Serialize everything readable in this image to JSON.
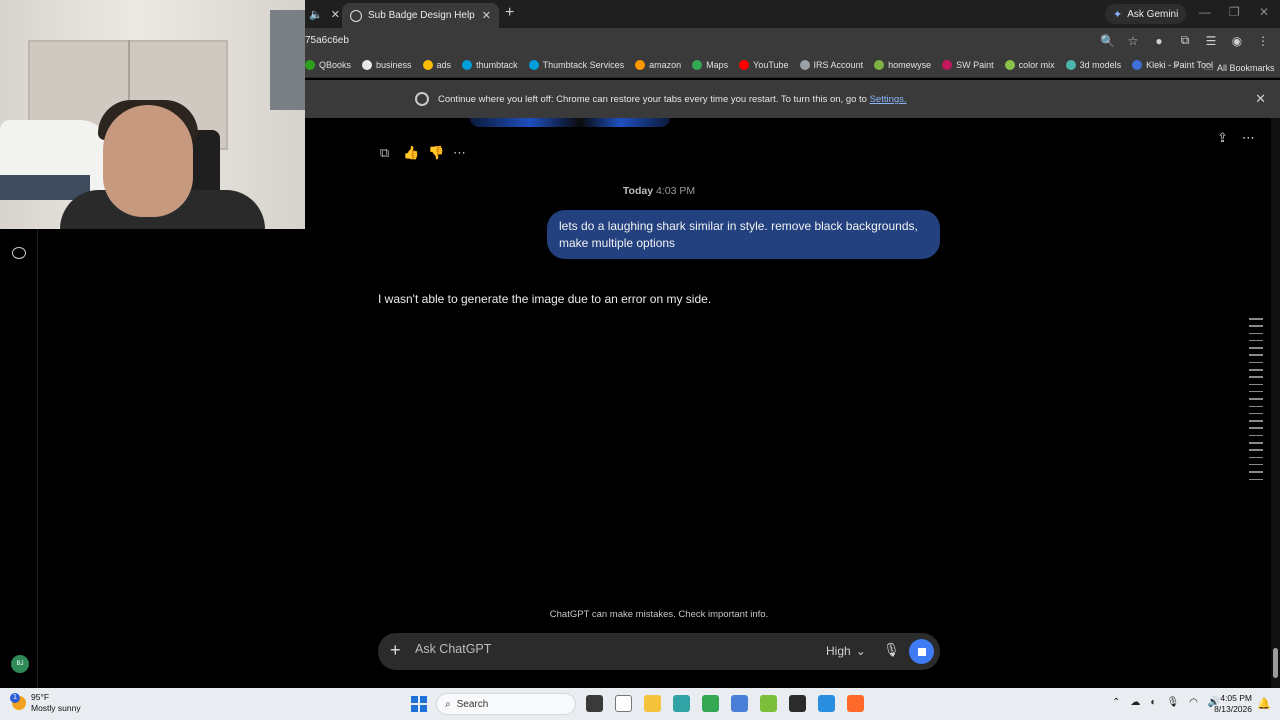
{
  "browser": {
    "prev_tab_audio_icon": "speaker-icon",
    "active_tab_title": "Sub Badge Design Help",
    "ask_gemini": "Ask Gemini",
    "url_fragment": "75a6c6eb",
    "bookmarks": [
      {
        "label": "QBooks",
        "color": "#2ca01c"
      },
      {
        "label": "business",
        "color": "#e8e8e8"
      },
      {
        "label": "ads",
        "color": "#fbbc04"
      },
      {
        "label": "thumbtack",
        "color": "#009fd9"
      },
      {
        "label": "Thumbtack Services",
        "color": "#009fd9"
      },
      {
        "label": "amazon",
        "color": "#ff9900"
      },
      {
        "label": "Maps",
        "color": "#34a853"
      },
      {
        "label": "YouTube",
        "color": "#ff0000"
      },
      {
        "label": "IRS Account",
        "color": "#9aa0a6"
      },
      {
        "label": "homewyse",
        "color": "#7cb342"
      },
      {
        "label": "SW Paint",
        "color": "#c2185b"
      },
      {
        "label": "color mix",
        "color": "#8bc34a"
      },
      {
        "label": "3d models",
        "color": "#4db6ac"
      },
      {
        "label": "Kleki - Paint Tool",
        "color": "#3f6fd8"
      }
    ],
    "bookmarks_more": "»",
    "all_bookmarks": "All Bookmarks",
    "infobar": {
      "text": "Continue where you left off: Chrome can restore your tabs every time you restart. To turn this on, go to ",
      "link": "Settings."
    }
  },
  "chat": {
    "timestamp_day": "Today",
    "timestamp_time": "4:03 PM",
    "user_message": "lets do a laughing shark similar in style. remove black backgrounds, make multiple options",
    "assistant_message": "I wasn't able to generate the image due to an error on my side.",
    "disclaimer": "ChatGPT can make mistakes. Check important info.",
    "composer_placeholder": "Ask ChatGPT",
    "model_label": "High",
    "avatar_initials": "BJ"
  },
  "taskbar": {
    "weather_temp": "95°F",
    "weather_desc": "Mostly sunny",
    "weather_badge": "1",
    "search_label": "Search",
    "time": "4:05 PM",
    "date": "8/13/2026",
    "apps": [
      {
        "name": "task-view",
        "color": "#3a3a3a"
      },
      {
        "name": "notepad",
        "color": "#ffffff"
      },
      {
        "name": "file-explorer",
        "color": "#f5c33b"
      },
      {
        "name": "edge",
        "color": "#2fa3a6"
      },
      {
        "name": "chrome",
        "color": "#34a853"
      },
      {
        "name": "notepad-plus",
        "color": "#4a7fd8"
      },
      {
        "name": "layers-app",
        "color": "#7cbf3a"
      },
      {
        "name": "obs",
        "color": "#2b2b2b"
      },
      {
        "name": "paint",
        "color": "#2a8ee0"
      },
      {
        "name": "firefox",
        "color": "#ff6a2b"
      }
    ]
  }
}
